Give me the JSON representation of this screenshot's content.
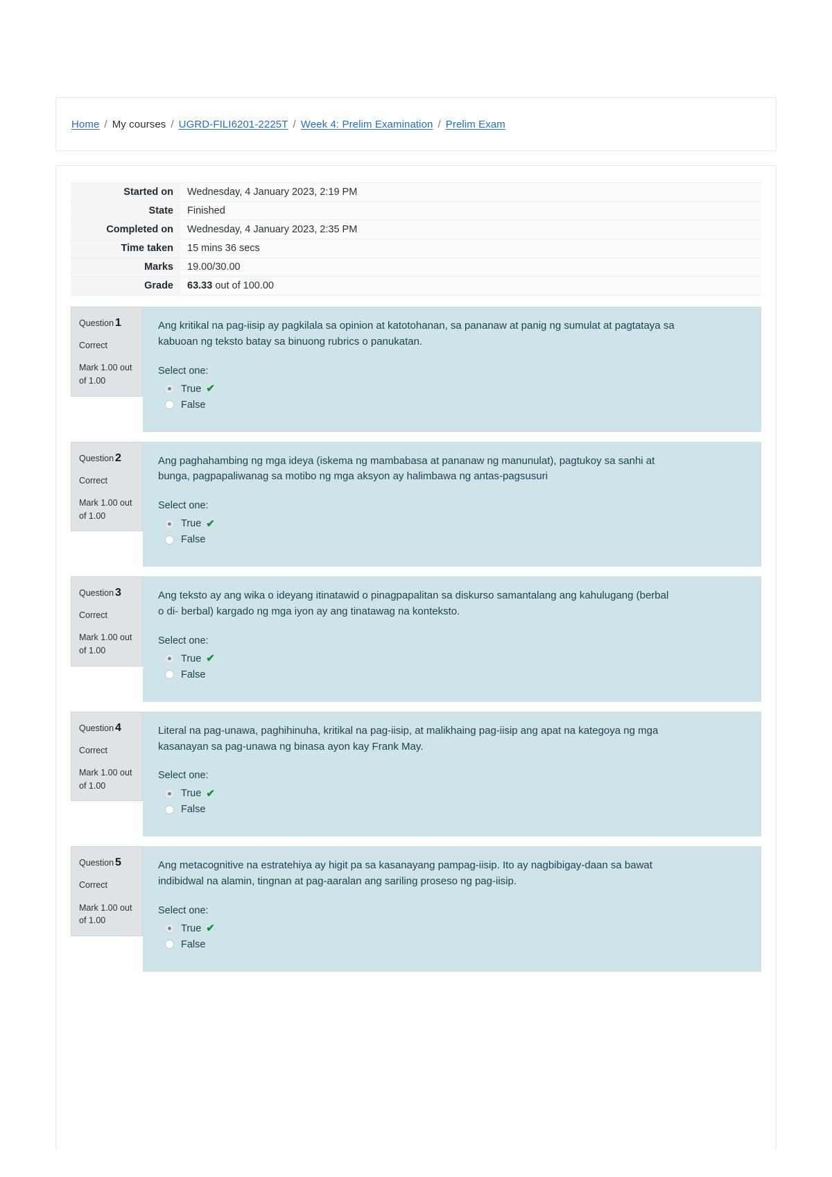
{
  "breadcrumb": {
    "items": [
      {
        "label": "Home",
        "link": true
      },
      {
        "label": "My courses",
        "link": false
      },
      {
        "label": "UGRD-FILI6201-2225T",
        "link": true
      },
      {
        "label": "Week 4: Prelim Examination",
        "link": true
      },
      {
        "label": "Prelim Exam",
        "link": true
      }
    ],
    "separator": "/"
  },
  "summary": {
    "rows": [
      {
        "label": "Started on",
        "value": "Wednesday, 4 January 2023, 2:19 PM"
      },
      {
        "label": "State",
        "value": "Finished"
      },
      {
        "label": "Completed on",
        "value": "Wednesday, 4 January 2023, 2:35 PM"
      },
      {
        "label": "Time taken",
        "value": "15 mins 36 secs"
      },
      {
        "label": "Marks",
        "value": "19.00/30.00"
      }
    ],
    "grade": {
      "label": "Grade",
      "score": "63.33",
      "suffix": " out of 100.00"
    }
  },
  "questions": [
    {
      "number_label": "Question",
      "number": "1",
      "state": "Correct",
      "mark": "Mark 1.00 out of 1.00",
      "text": "Ang kritikal na pag-iisip ay pagkilala sa opinion at katotohanan, sa pananaw at panig ng sumulat at pagtataya sa kabuoan ng teksto batay sa binuong rubrics o panukatan.",
      "prompt": "Select one:",
      "options": [
        {
          "label": "True",
          "selected": true,
          "correct": true
        },
        {
          "label": "False",
          "selected": false,
          "correct": false
        }
      ]
    },
    {
      "number_label": "Question",
      "number": "2",
      "state": "Correct",
      "mark": "Mark 1.00 out of 1.00",
      "text": "Ang paghahambing ng mga ideya (iskema ng mambabasa at pananaw ng manunulat), pagtukoy sa sanhi at bunga, pagpapaliwanag sa motibo ng mga aksyon ay halimbawa ng antas-pagsusuri",
      "prompt": "Select one:",
      "options": [
        {
          "label": "True",
          "selected": true,
          "correct": true
        },
        {
          "label": "False",
          "selected": false,
          "correct": false
        }
      ]
    },
    {
      "number_label": "Question",
      "number": "3",
      "state": "Correct",
      "mark": "Mark 1.00 out of 1.00",
      "text": "Ang teksto ay ang wika o ideyang itinatawid o pinagpapalitan sa diskurso samantalang ang kahulugang (berbal o di- berbal) kargado ng mga iyon ay ang tinatawag na konteksto.",
      "prompt": "Select one:",
      "options": [
        {
          "label": "True",
          "selected": true,
          "correct": true
        },
        {
          "label": "False",
          "selected": false,
          "correct": false
        }
      ]
    },
    {
      "number_label": "Question",
      "number": "4",
      "state": "Correct",
      "mark": "Mark 1.00 out of 1.00",
      "text": "Literal na pag-unawa, paghihinuha, kritikal na pag-iisip, at malikhaing pag-iisip ang apat na kategoya ng mga kasanayan sa pag-unawa ng binasa ayon kay Frank May.",
      "prompt": "Select one:",
      "options": [
        {
          "label": "True",
          "selected": true,
          "correct": true
        },
        {
          "label": "False",
          "selected": false,
          "correct": false
        }
      ]
    },
    {
      "number_label": "Question",
      "number": "5",
      "state": "Correct",
      "mark": "Mark 1.00 out of 1.00",
      "text": "Ang metacognitive na estratehiya ay higit pa sa kasanayang pampag-iisip. Ito ay nagbibigay-daan sa bawat indibidwal na alamin, tingnan at pag-aaralan ang sariling proseso ng pag-iisip.",
      "prompt": "Select one:",
      "options": [
        {
          "label": "True",
          "selected": true,
          "correct": true
        },
        {
          "label": "False",
          "selected": false,
          "correct": false
        }
      ]
    }
  ],
  "icons": {
    "correct_check": "✔"
  },
  "colors": {
    "link": "#1d6fd4",
    "question_body_bg": "#cfe4e8",
    "question_info_bg": "#dfe3e6",
    "correct_green": "#179134",
    "question_text": "#1b4450"
  }
}
